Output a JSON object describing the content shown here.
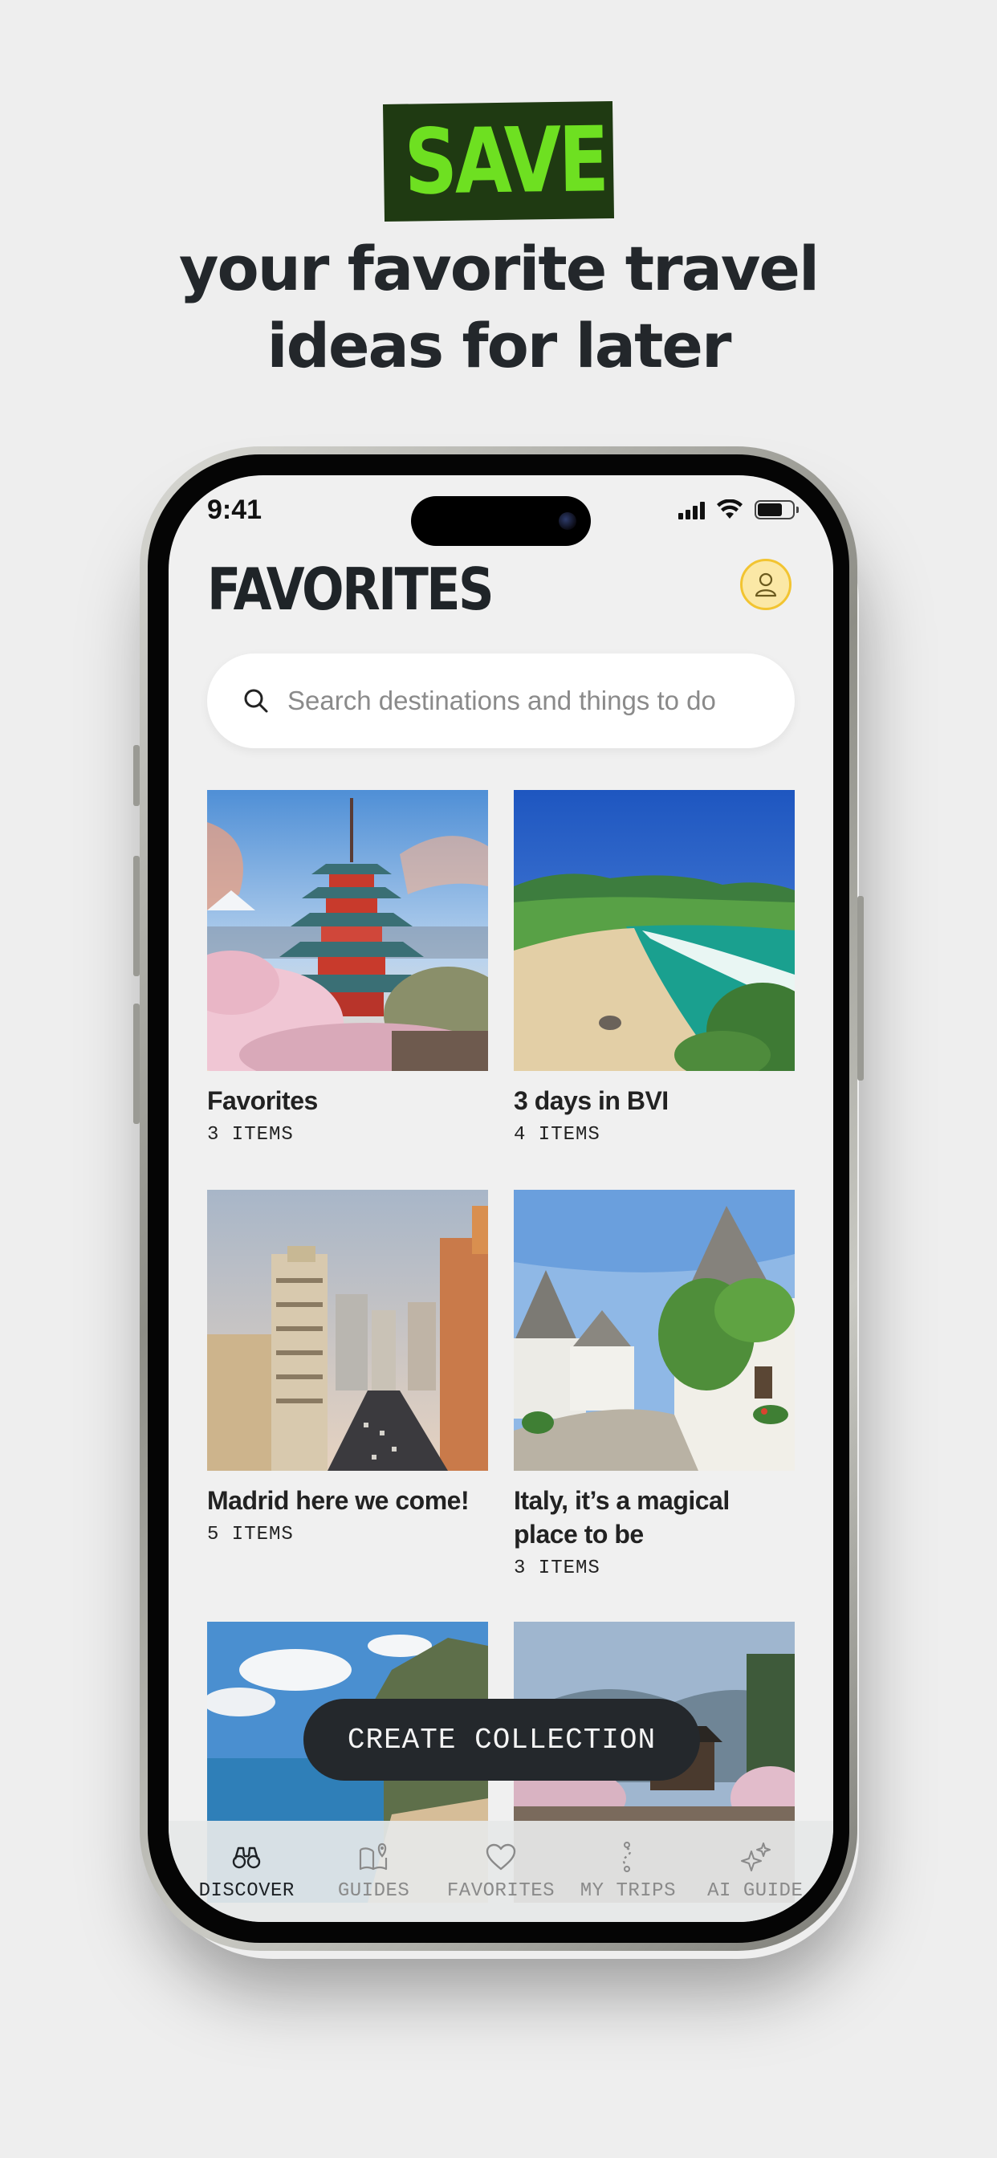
{
  "hero": {
    "badge": "SAVE",
    "line1": "your favorite travel",
    "line2": "ideas for later"
  },
  "status_bar": {
    "time": "9:41"
  },
  "header": {
    "title": "FAVORITES",
    "avatar_icon": "person-icon"
  },
  "search": {
    "placeholder": "Search destinations and things to do",
    "icon": "search-icon"
  },
  "collections": [
    {
      "title": "Favorites",
      "count": "3 ITEMS"
    },
    {
      "title": "3 days in BVI",
      "count": "4 ITEMS"
    },
    {
      "title": "Madrid here we come!",
      "count": "5 ITEMS"
    },
    {
      "title": "Italy, it’s a magical place to be",
      "count": "3 ITEMS"
    }
  ],
  "create_button": "CREATE COLLECTION",
  "tabs": [
    {
      "label": "DISCOVER",
      "icon": "binoculars-icon",
      "active": true
    },
    {
      "label": "GUIDES",
      "icon": "map-guide-icon",
      "active": false
    },
    {
      "label": "FAVORITES",
      "icon": "heart-icon",
      "active": false
    },
    {
      "label": "MY TRIPS",
      "icon": "route-icon",
      "active": false
    },
    {
      "label": "AI GUIDE",
      "icon": "sparkles-icon",
      "active": false
    }
  ],
  "colors": {
    "badge_bg": "#1f3a12",
    "badge_text": "#6ee021",
    "avatar_ring": "#f2c431",
    "button_dark": "#24282c"
  }
}
